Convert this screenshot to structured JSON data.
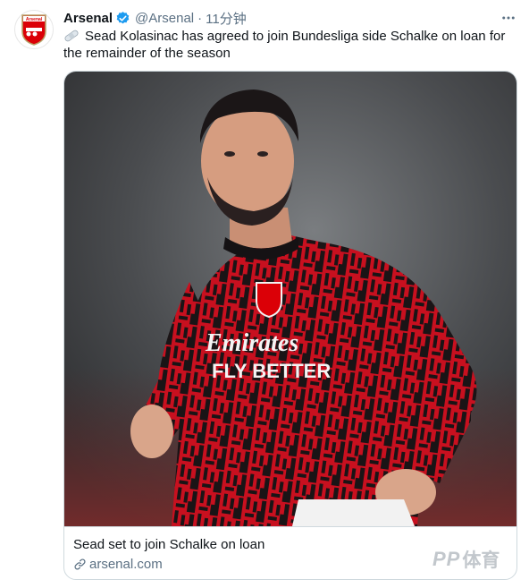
{
  "tweet": {
    "author": {
      "display_name": "Arsenal",
      "handle": "@Arsenal",
      "verified_icon": "verified-badge-icon",
      "avatar_icon": "arsenal-crest",
      "avatar_text": "Arsenal"
    },
    "separator": "·",
    "time": "11分钟",
    "more_icon": "more-horizontal-icon",
    "text_icon": "bandage-emoji",
    "text": "Sead Kolasinac has agreed to join Bundesliga side Schalke on loan for the remainder of the season",
    "card": {
      "title": "Sead set to join Schalke on loan",
      "domain": "arsenal.com",
      "domain_icon": "link-icon",
      "shirt_sponsor": "Emirates",
      "shirt_sponsor_line2": "FLY BETTER"
    }
  },
  "watermark": {
    "logo": "PP",
    "text": "体育"
  },
  "colors": {
    "verified_blue": "#1d9bf0",
    "secondary_text": "#5b7083",
    "arsenal_red": "#db0007",
    "border": "#cfd9de"
  }
}
